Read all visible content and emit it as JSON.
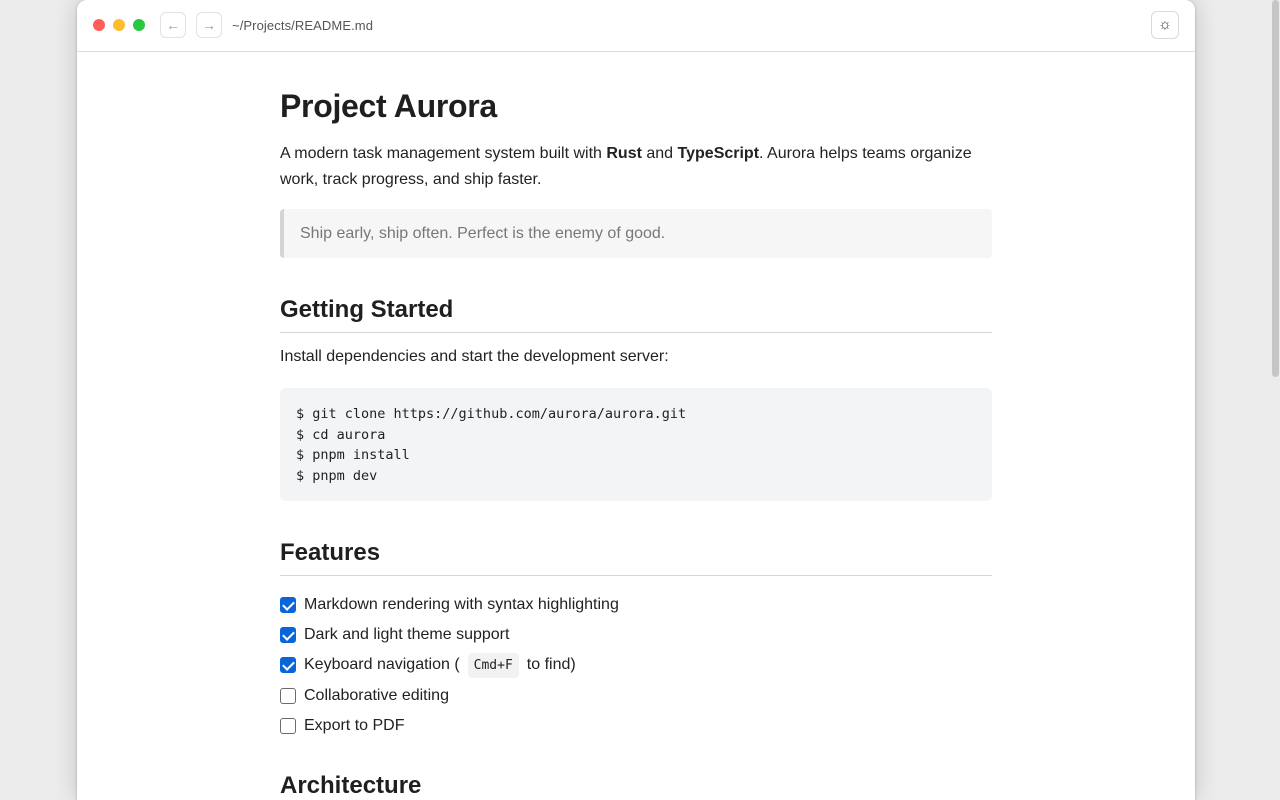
{
  "window": {
    "path": "~/Projects/README.md",
    "back_icon": "←",
    "forward_icon": "→",
    "theme_icon": "☼"
  },
  "doc": {
    "title": "Project Aurora",
    "intro": {
      "t1": "A modern task management system built with ",
      "b1": "Rust",
      "t2": " and ",
      "b2": "TypeScript",
      "t3": ". Aurora helps teams organize work, track progress, and ship faster."
    },
    "quote": "Ship early, ship often. Perfect is the enemy of good.",
    "getting_started": {
      "heading": "Getting Started",
      "text": "Install dependencies and start the development server:",
      "code": [
        "$ git clone https://github.com/aurora/aurora.git",
        "$ cd aurora",
        "$ pnpm install",
        "$ pnpm dev"
      ]
    },
    "features": {
      "heading": "Features",
      "items": [
        {
          "label": "Markdown rendering with syntax highlighting",
          "checked": true
        },
        {
          "label": "Dark and light theme support",
          "checked": true
        },
        {
          "label_pre": "Keyboard navigation (",
          "kbd": "Cmd+F",
          "label_post": "to find)",
          "checked": true
        },
        {
          "label": "Collaborative editing",
          "checked": false
        },
        {
          "label": "Export to PDF",
          "checked": false
        }
      ]
    },
    "architecture": {
      "heading": "Architecture"
    }
  },
  "colors": {
    "accent": "#0a66d8",
    "close": "#ff5f57",
    "minimize": "#febc2e",
    "zoom": "#28c840"
  }
}
